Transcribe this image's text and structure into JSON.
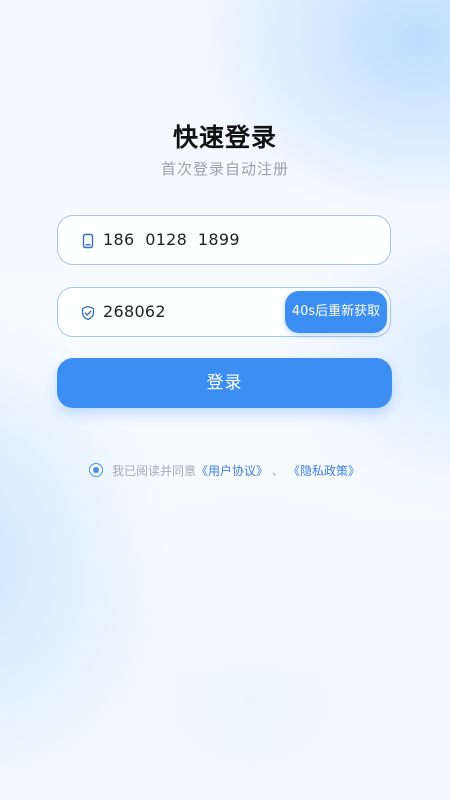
{
  "header": {
    "title": "快速登录",
    "subtitle": "首次登录自动注册"
  },
  "phone_field": {
    "icon": "phone-icon",
    "value": "186  0128  1899"
  },
  "code_field": {
    "icon": "shield-check-icon",
    "value": "268062",
    "resend_label": "40s后重新获取"
  },
  "login_button": {
    "label": "登录"
  },
  "agreement": {
    "checked": true,
    "prefix": "我已阅读并同意",
    "user_agreement_link": "《用户协议》",
    "separator": "、",
    "privacy_policy_link": "《隐私政策》"
  },
  "colors": {
    "accent": "#3d8ef2",
    "link": "#3d7fe0",
    "field_border": "#a9c6ea",
    "subtitle_text": "#9aa1ab"
  }
}
